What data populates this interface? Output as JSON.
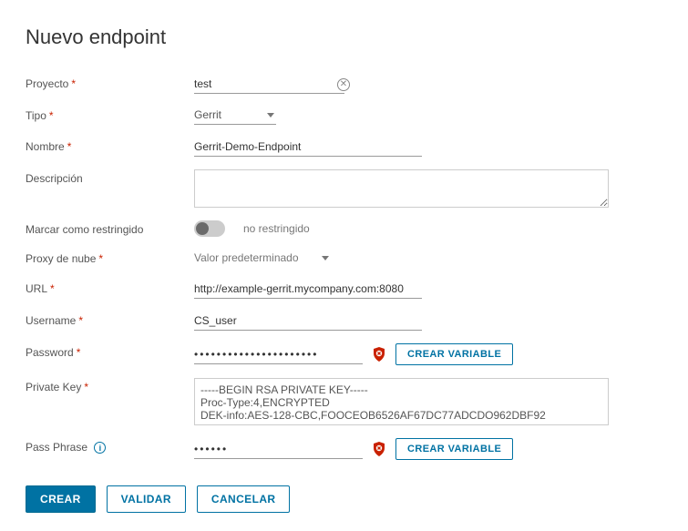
{
  "title": "Nuevo endpoint",
  "labels": {
    "proyecto": "Proyecto",
    "tipo": "Tipo",
    "nombre": "Nombre",
    "descripcion": "Descripción",
    "marcar": "Marcar como restringido",
    "proxy": "Proxy de nube",
    "url": "URL",
    "username": "Username",
    "password": "Password",
    "private_key": "Private Key",
    "passphrase": "Pass Phrase"
  },
  "values": {
    "proyecto": "test",
    "tipo": "Gerrit",
    "nombre": "Gerrit-Demo-Endpoint",
    "descripcion": "",
    "restringido_label": "no restringido",
    "proxy": "Valor predeterminado",
    "url": "http://example-gerrit.mycompany.com:8080",
    "username": "CS_user",
    "password": "••••••••••••••••••••••",
    "private_key": "-----BEGIN RSA PRIVATE KEY-----\nProc-Type:4,ENCRYPTED\nDEK-info:AES-128-CBC,FOOCEOB6526AF67DC77ADCDO962DBF92",
    "passphrase": "••••••"
  },
  "buttons": {
    "crear_variable": "CREAR VARIABLE",
    "crear": "CREAR",
    "validar": "VALIDAR",
    "cancelar": "CANCELAR"
  }
}
